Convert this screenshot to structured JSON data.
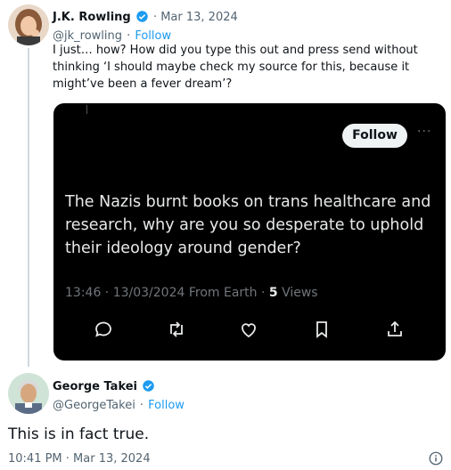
{
  "first_tweet": {
    "author_name": "J.K. Rowling",
    "date": "· Mar 13, 2024",
    "handle": "@jk_rowling",
    "separator": "·",
    "follow_label": "Follow",
    "text": "I just… how? How did you type this out and press send without thinking ‘I should maybe check my source for this, because it might’ve been a fever dream’?"
  },
  "embedded_card": {
    "follow_label": "Follow",
    "more_label": "···",
    "text": "The Nazis burnt books on trans healthcare and research, why are you so desperate to uphold their ideology around gender?",
    "meta_prefix": "13:46 · 13/03/2024 From Earth · ",
    "views_count": "5",
    "views_label": " Views",
    "actions": [
      "reply-icon",
      "retweet-icon",
      "like-icon",
      "bookmark-icon",
      "share-icon"
    ]
  },
  "second_tweet": {
    "author_name": "George Takei",
    "handle": "@GeorgeTakei",
    "separator": "·",
    "follow_label": "Follow",
    "text": "This is in fact true.",
    "timestamp": "10:41 PM · Mar 13, 2024",
    "info_icon": "info-icon"
  },
  "colors": {
    "link_blue": "#1d9bf0",
    "verified_blue": "#1d9bf0",
    "card_bg": "#000000",
    "muted_gray": "#536471"
  }
}
